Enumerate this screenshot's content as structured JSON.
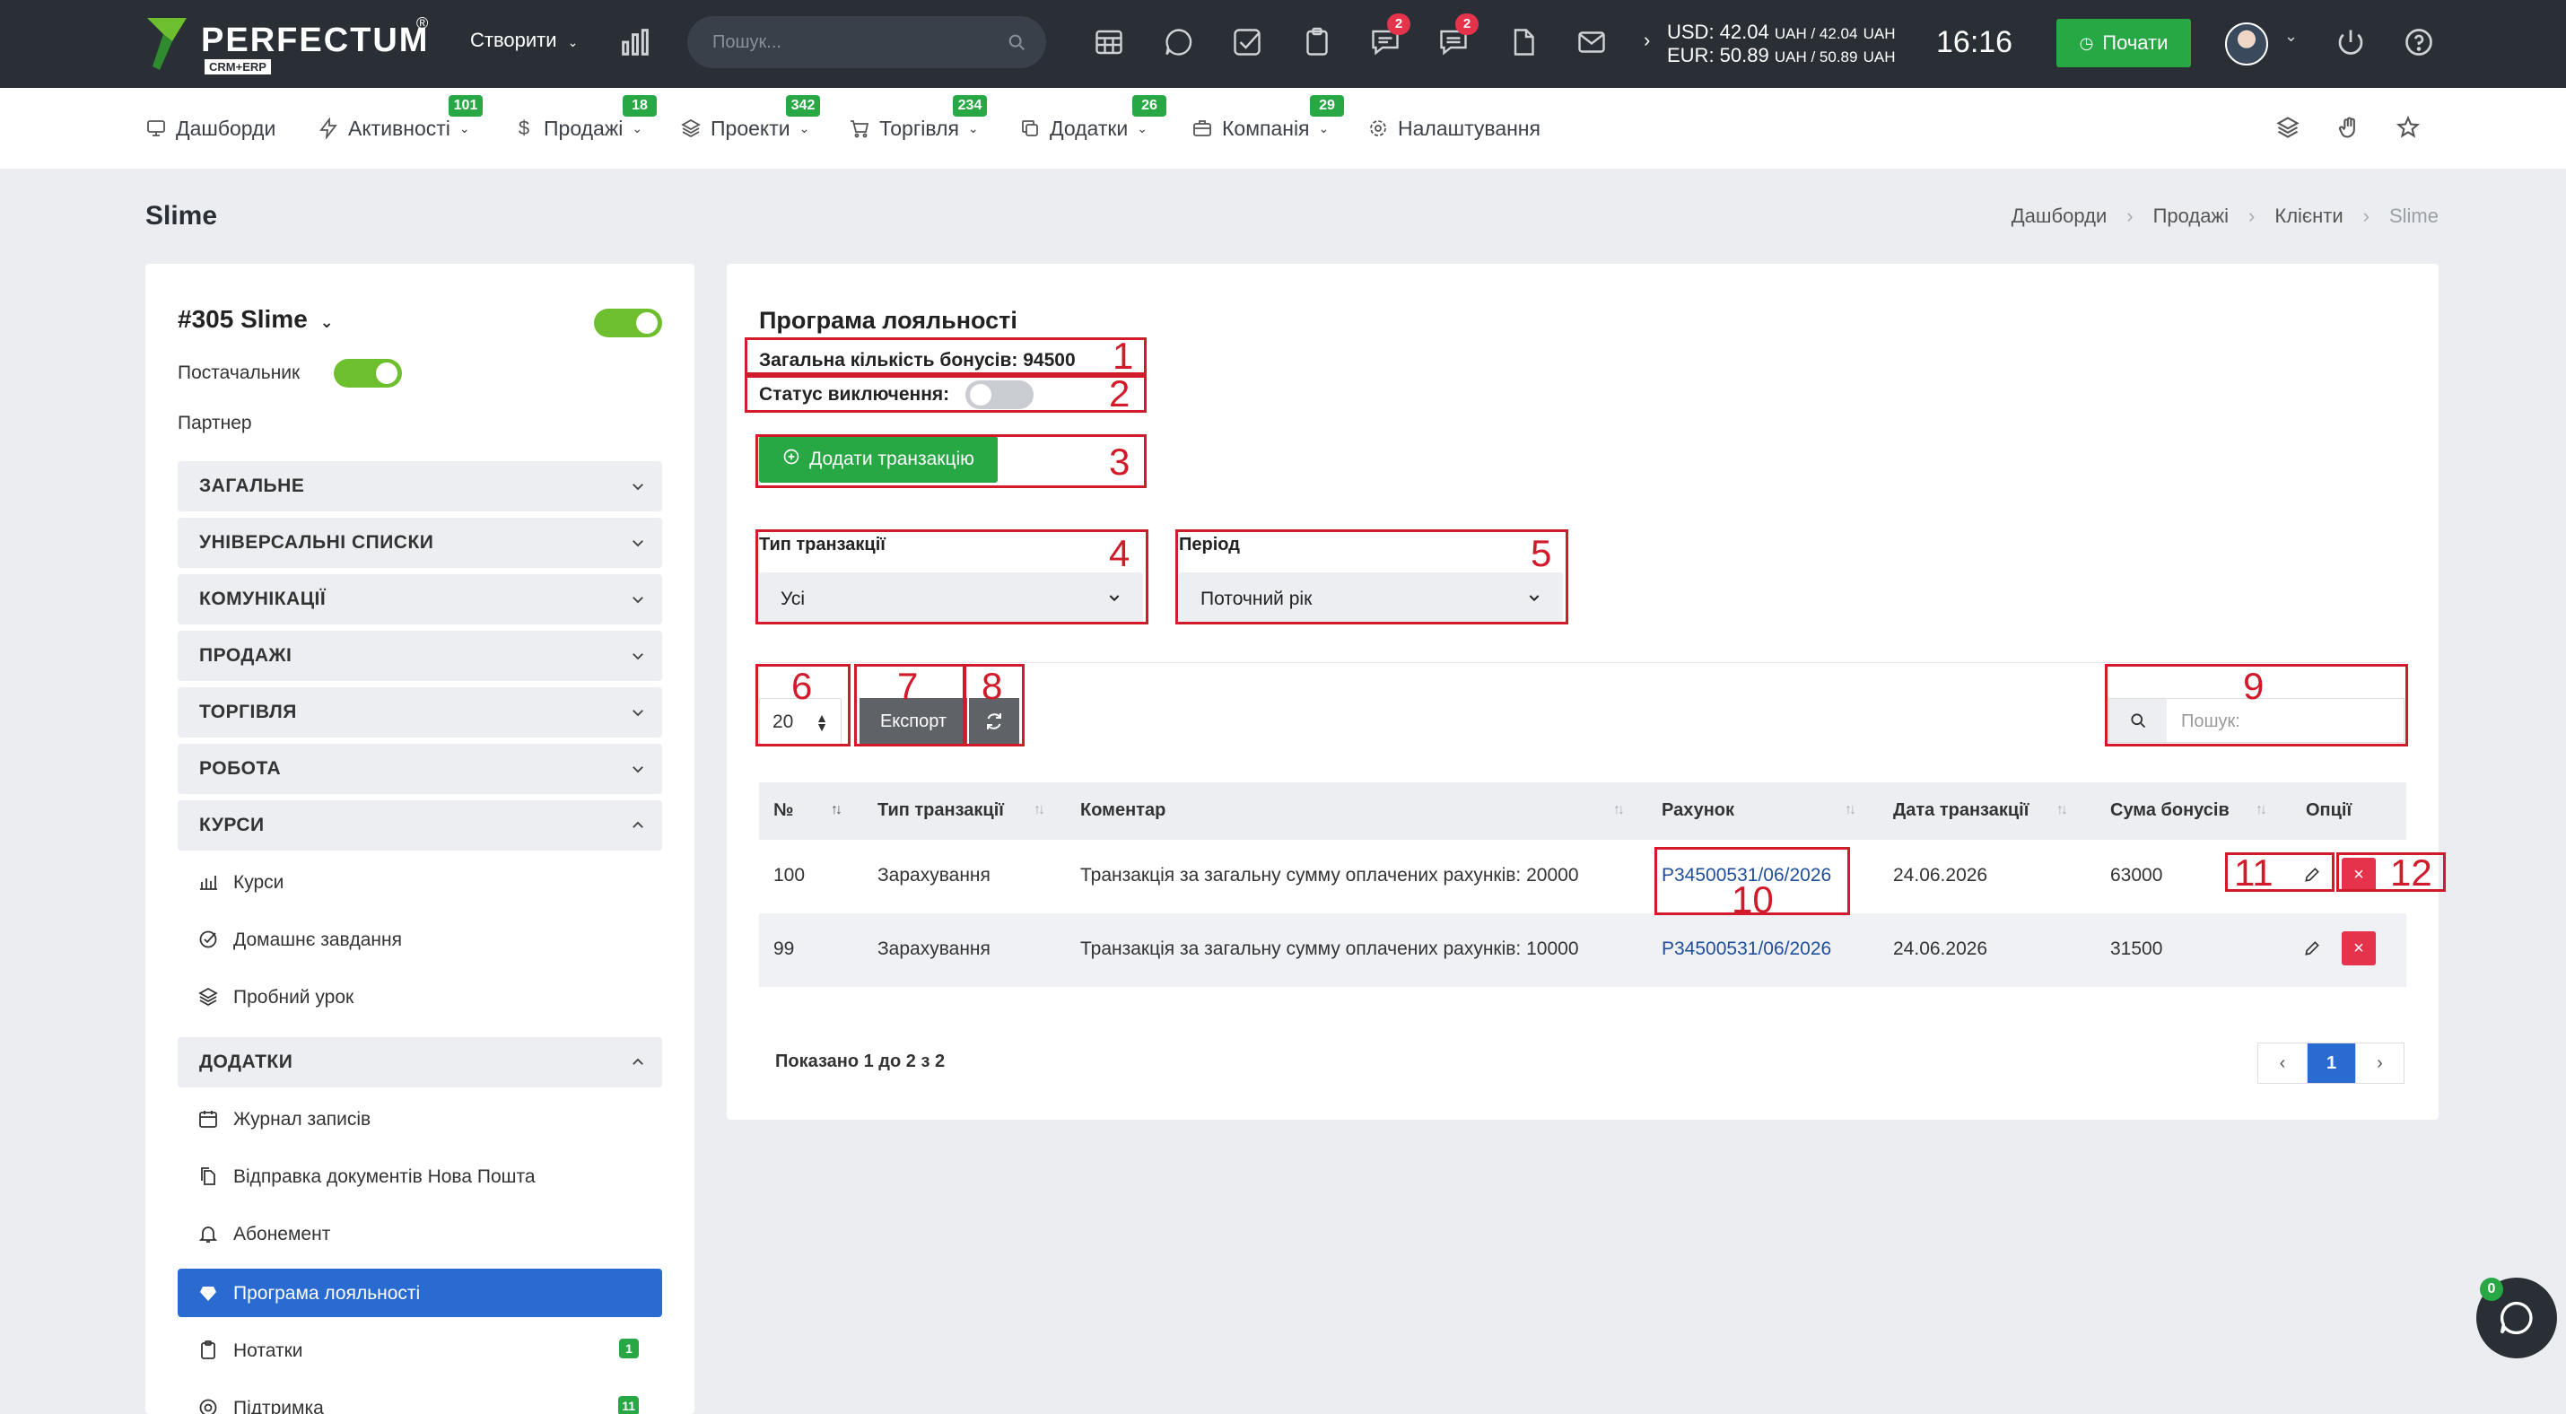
{
  "app": {
    "brand": "PERFECTUM",
    "brand_sub": "CRM+ERP",
    "brand_reg": "®"
  },
  "topbar": {
    "create_label": "Створити",
    "search_placeholder": "Пошук...",
    "icons": [
      "chart-icon",
      "calendar-table-icon",
      "chat-icon",
      "checkbox-icon",
      "clipboard-icon",
      "comment-icon",
      "message-icon",
      "document-icon",
      "mail-icon"
    ],
    "badges": {
      "comment": "2",
      "message": "2"
    },
    "rates": {
      "usd": "USD: 42.04",
      "usd_b": "UAH / 42.04",
      "usd_c": "UAH",
      "eur": "EUR: 50.89",
      "eur_b": "UAH / 50.89",
      "eur_c": "UAH"
    },
    "clock": "16:16",
    "start_label": "Почати"
  },
  "nav": {
    "items": [
      {
        "label": "Дашборди",
        "badge": ""
      },
      {
        "label": "Активності",
        "badge": "101"
      },
      {
        "label": "Продажі",
        "badge": "18"
      },
      {
        "label": "Проекти",
        "badge": "342"
      },
      {
        "label": "Торгівля",
        "badge": "234"
      },
      {
        "label": "Додатки",
        "badge": "26"
      },
      {
        "label": "Компанія",
        "badge": "29"
      },
      {
        "label": "Налаштування",
        "badge": ""
      }
    ]
  },
  "page": {
    "title": "Slime",
    "breadcrumb": [
      "Дашборди",
      "Продажі",
      "Клієнти",
      "Slime"
    ]
  },
  "sidebar": {
    "client_title": "#305 Slime",
    "supplier_label": "Постачальник",
    "partner_label": "Партнер",
    "sections": [
      "ЗАГАЛЬНЕ",
      "УНІВЕРСАЛЬНІ СПИСКИ",
      "КОМУНІКАЦІЇ",
      "ПРОДАЖІ",
      "ТОРГІВЛЯ",
      "РОБОТА",
      "КУРСИ",
      "ДОДАТКИ"
    ],
    "courses_items": [
      "Курси",
      "Домашнє завдання",
      "Пробний урок"
    ],
    "addons_items": [
      "Журнал записів",
      "Відправка документів Нова Пошта",
      "Абонемент",
      "Програма лояльності",
      "Нотатки",
      "Підтримка"
    ],
    "notes_count": "1",
    "support_count": "11"
  },
  "loyalty": {
    "heading": "Програма лояльності",
    "total_bonus": "Загальна кількість бонусів: 94500",
    "status_label": "Статус виключення:",
    "add_button": "Додати транзакцію",
    "filters": {
      "type_label": "Тип транзакції",
      "type_value": "Усі",
      "period_label": "Період",
      "period_value": "Поточний рік"
    },
    "page_size": "20",
    "export_label": "Експорт",
    "search_placeholder": "Пошук:",
    "columns": [
      "№",
      "Тип транзакції",
      "Коментар",
      "Рахунок",
      "Дата транзакції",
      "Сума бонусів",
      "Опції"
    ],
    "rows": [
      {
        "num": "100",
        "type": "Зарахування",
        "comment": "Транзакція за загальну сумму оплачених рахунків: 20000",
        "invoice": "P34500531/06/2026",
        "date": "24.06.2026",
        "sum": "63000"
      },
      {
        "num": "99",
        "type": "Зарахування",
        "comment": "Транзакція за загальну сумму оплачених рахунків: 10000",
        "invoice": "P34500531/06/2026",
        "date": "24.06.2026",
        "sum": "31500"
      }
    ],
    "shown_text": "Показано 1 до 2 з 2",
    "pager": {
      "prev": "‹",
      "current": "1",
      "next": "›"
    }
  },
  "annotations": [
    "1",
    "2",
    "3",
    "4",
    "5",
    "6",
    "7",
    "8",
    "9",
    "10",
    "11",
    "12"
  ],
  "chat": {
    "badge": "0"
  },
  "colors": {
    "topbar": "#2a2f36",
    "accent_green": "#28a745",
    "primary_blue": "#2a6bd1",
    "danger_red": "#e5334c",
    "annotation_red": "#d11a2a"
  }
}
